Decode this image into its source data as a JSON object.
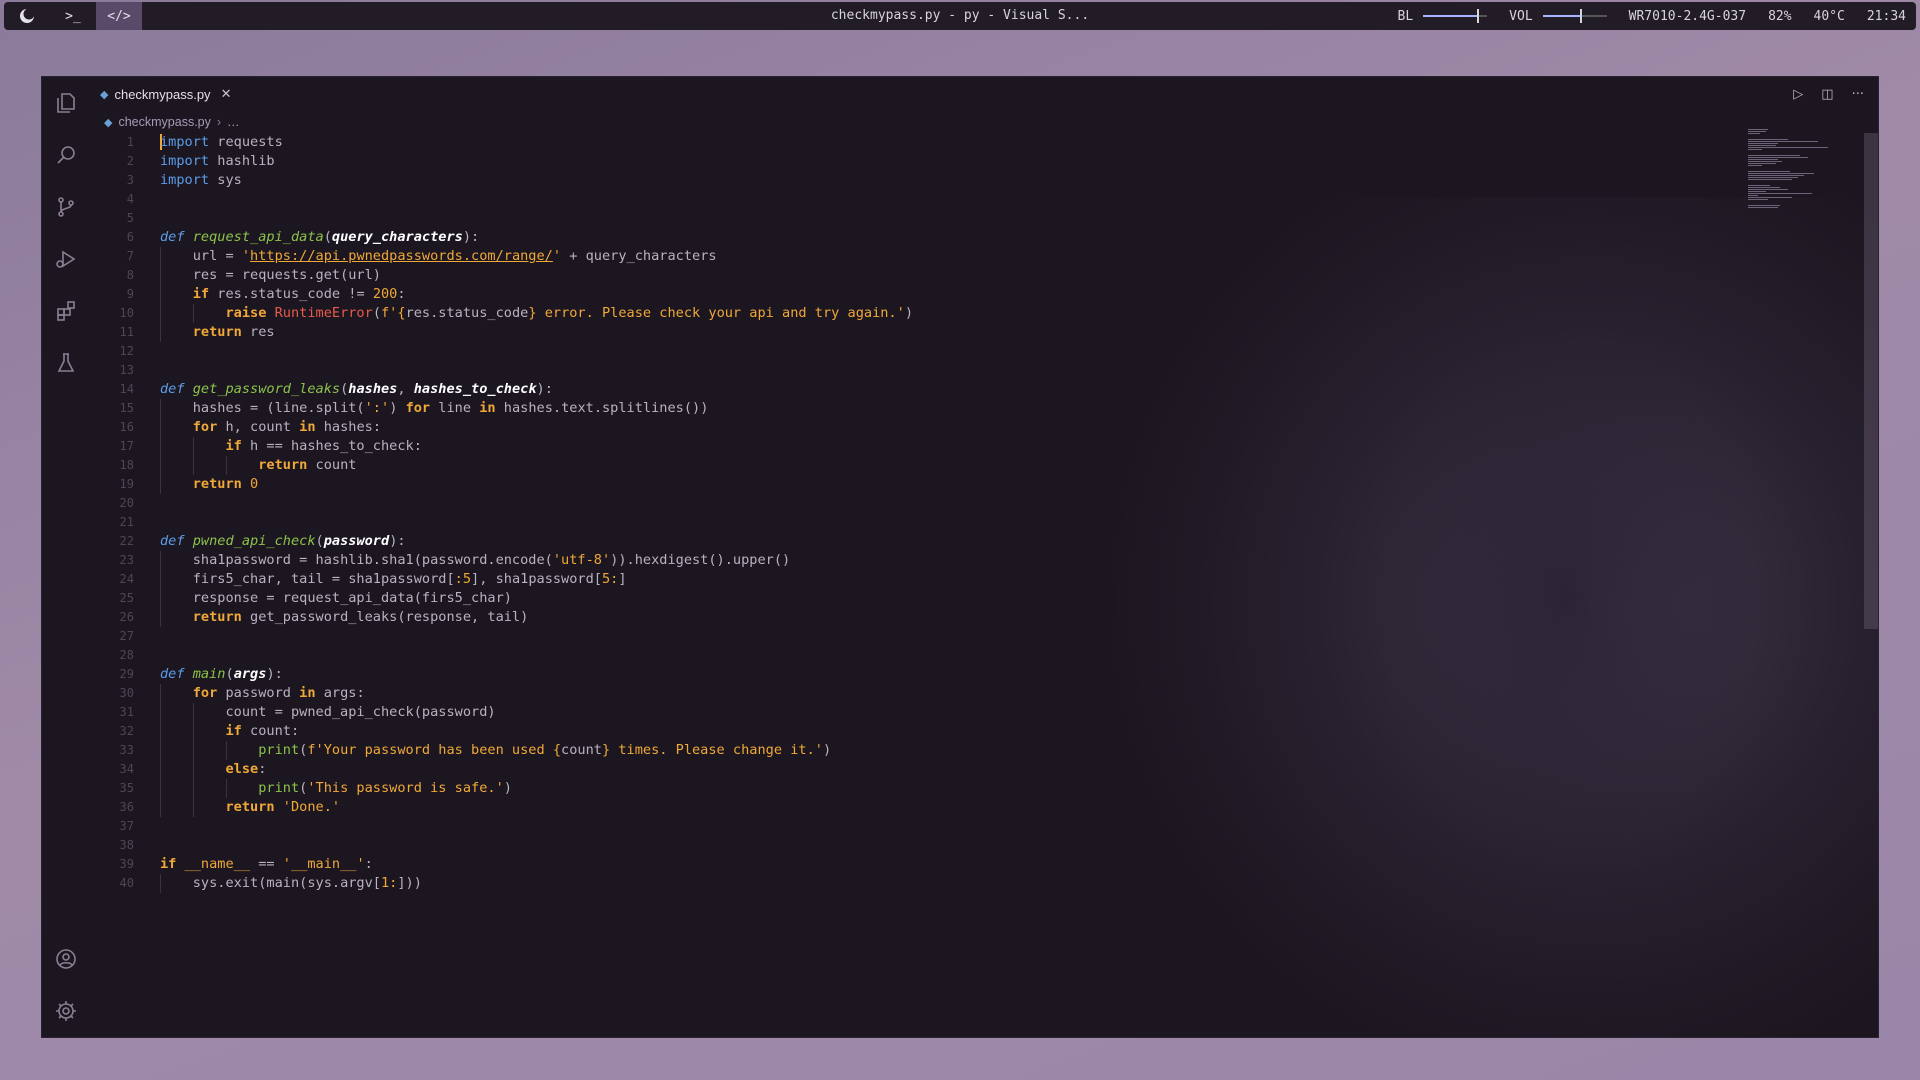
{
  "topbar": {
    "title": "checkmypass.py - py - Visual S...",
    "backlight_label": "BL",
    "backlight_level": 0.85,
    "volume_label": "VOL",
    "volume_level": 0.6,
    "wifi": "WR7010-2.4G-037",
    "battery": "82%",
    "temperature": "40°C",
    "clock": "21:34"
  },
  "tab": {
    "filename": "checkmypass.py"
  },
  "breadcrumb": {
    "file": "checkmypass.py",
    "more": "…"
  },
  "colors": {
    "keyword": "#f0a838",
    "import": "#5a9ce8",
    "function": "#8bc34a",
    "string": "#f0a838",
    "error": "#e85a4a",
    "background": "#1c1620"
  },
  "icons": [
    "explorer-icon",
    "search-icon",
    "source-control-icon",
    "run-debug-icon",
    "extensions-icon",
    "testing-icon",
    "account-icon",
    "settings-gear-icon",
    "run-icon",
    "split-editor-icon",
    "more-icon"
  ],
  "code": {
    "l1_kw": "import",
    "l1_rest": " requests",
    "l2_kw": "import",
    "l2_rest": " hashlib",
    "l3_kw": "import",
    "l3_rest": " sys",
    "l6_def": "def",
    "l6_fn": "request_api_data",
    "l6_p": "query_characters",
    "l7_a": "url = ",
    "l7_q1": "'",
    "l7_url": "https://api.pwnedpasswords.com/range/",
    "l7_q2": "'",
    "l7_b": " + query_characters",
    "l8": "res = requests.get(url)",
    "l9_kw": "if",
    "l9_a": " res.status_code != ",
    "l9_num": "200",
    "l9_b": ":",
    "l10_kw": "raise",
    "l10_err": "RuntimeError",
    "l10_a": "(",
    "l10_f": "f'",
    "l10_b": "{",
    "l10_c": "res.status_code",
    "l10_d": "}",
    "l10_s": " error. Please check your api and try again.'",
    "l10_e": ")",
    "l11_kw": "return",
    "l11_a": " res",
    "l14_def": "def",
    "l14_fn": "get_password_leaks",
    "l14_p1": "hashes",
    "l14_p2": "hashes_to_check",
    "l15_a": "hashes = (line.split(",
    "l15_s": "':'",
    "l15_b": ") ",
    "l15_kw": "for",
    "l15_c": " line ",
    "l15_kw2": "in",
    "l15_d": " hashes.text.splitlines())",
    "l16_kw": "for",
    "l16_a": " h, count ",
    "l16_kw2": "in",
    "l16_b": " hashes:",
    "l17_kw": "if",
    "l17_a": " h == hashes_to_check:",
    "l18_kw": "return",
    "l18_a": " count",
    "l19_kw": "return",
    "l19_num": " 0",
    "l22_def": "def",
    "l22_fn": "pwned_api_check",
    "l22_p": "password",
    "l23_a": "sha1password = hashlib.sha1(password.encode(",
    "l23_s": "'utf-8'",
    "l23_b": ")).hexdigest().upper()",
    "l24_a": "firs5_char, tail = sha1password[",
    "l24_n1": ":5",
    "l24_b": "], sha1password[",
    "l24_n2": "5:",
    "l24_c": "]",
    "l25": "response = request_api_data(firs5_char)",
    "l26_kw": "return",
    "l26_a": " get_password_leaks(response, tail)",
    "l29_def": "def",
    "l29_fn": "main",
    "l29_p": "args",
    "l30_kw": "for",
    "l30_a": " password ",
    "l30_kw2": "in",
    "l30_b": " args:",
    "l31": "count = pwned_api_check(password)",
    "l32_kw": "if",
    "l32_a": " count:",
    "l33_bi": "print",
    "l33_a": "(",
    "l33_f": "f'Your password has been used ",
    "l33_b": "{",
    "l33_c": "count",
    "l33_d": "}",
    "l33_s": " times. Please change it.'",
    "l33_e": ")",
    "l34_kw": "else",
    "l34_a": ":",
    "l35_bi": "print",
    "l35_a": "(",
    "l35_s": "'This password is safe.'",
    "l35_b": ")",
    "l36_kw": "return",
    "l36_s": " 'Done.'",
    "l39_kw": "if",
    "l39_a": " __name__",
    "l39_b": " == ",
    "l39_s": "'__main__'",
    "l39_c": ":",
    "l40_a": "sys.exit(main(sys.argv[",
    "l40_n": "1:",
    "l40_b": "]))"
  }
}
